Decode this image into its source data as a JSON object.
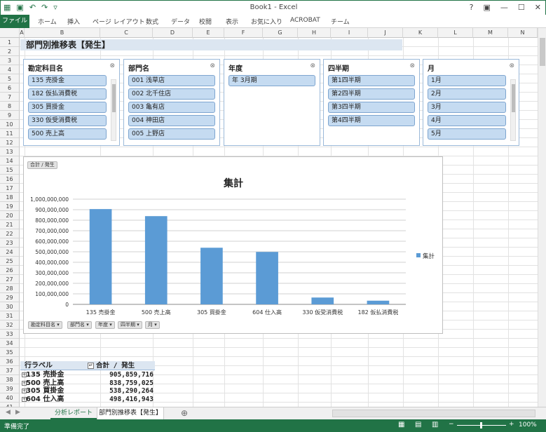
{
  "window": {
    "title": "Book1 - Excel",
    "qat_icons": [
      "excel-logo-icon",
      "save-icon",
      "undo-icon",
      "redo-icon",
      "customize-icon"
    ],
    "controls": [
      "?",
      "▣",
      "—",
      "☐",
      "✕"
    ]
  },
  "ribbon": {
    "tabs": [
      "ファイル",
      "ホーム",
      "挿入",
      "ページ レイアウト",
      "数式",
      "データ",
      "校閲",
      "表示",
      "お気に入り",
      "ACROBAT",
      "チーム"
    ]
  },
  "columns": [
    "A",
    "B",
    "C",
    "D",
    "E",
    "F",
    "G",
    "H",
    "I",
    "J",
    "K",
    "L",
    "M",
    "N"
  ],
  "rows": [
    "1",
    "2",
    "3",
    "4",
    "5",
    "6",
    "7",
    "8",
    "9",
    "10",
    "11",
    "12",
    "13",
    "14",
    "15",
    "16",
    "17",
    "18",
    "19",
    "20",
    "21",
    "22",
    "23",
    "24",
    "25",
    "26",
    "27",
    "28",
    "29",
    "30",
    "31",
    "32",
    "33",
    "34",
    "35",
    "36",
    "37",
    "38",
    "39",
    "40",
    "41"
  ],
  "sheet_title": "部門別推移表【発生】",
  "slicers": [
    {
      "title": "勘定科目名",
      "items": [
        "135 売掛金",
        "182 仮払消費税",
        "305 買掛金",
        "330 仮受消費税",
        "500 売上高"
      ],
      "scroll": true
    },
    {
      "title": "部門名",
      "items": [
        "001 浅草店",
        "002 北千住店",
        "003 亀有店",
        "004 神田店",
        "005 上野店"
      ],
      "scroll": false
    },
    {
      "title": "年度",
      "items": [
        "年 3月期"
      ],
      "scroll": false
    },
    {
      "title": "四半期",
      "items": [
        "第1四半期",
        "第2四半期",
        "第3四半期",
        "第4四半期"
      ],
      "scroll": false
    },
    {
      "title": "月",
      "items": [
        "1月",
        "2月",
        "3月",
        "4月",
        "5月"
      ],
      "scroll": true
    }
  ],
  "chart_field_top": "合計 / 発生",
  "chart_field_bottom": [
    "勘定科目名",
    "部門名",
    "年度",
    "四半期",
    "月"
  ],
  "chart_data": {
    "type": "bar",
    "title": "集計",
    "categories": [
      "135 売掛金",
      "500 売上高",
      "305 買掛金",
      "604 仕入高",
      "330 仮受消費税",
      "182 仮払消費税"
    ],
    "series": [
      {
        "name": "集計",
        "values": [
          905859716,
          838759025,
          538290264,
          498416943,
          65000000,
          35000000
        ]
      }
    ],
    "ylim": [
      0,
      1000000000
    ],
    "yticks": [
      "0",
      "100,000,000",
      "200,000,000",
      "300,000,000",
      "400,000,000",
      "500,000,000",
      "600,000,000",
      "700,000,000",
      "800,000,000",
      "900,000,000",
      "1,000,000,000"
    ],
    "legend": "right",
    "grid": true,
    "color": "#5b9bd5"
  },
  "pivot": {
    "header_label": "行ラベル",
    "header_value": "合計 / 発生",
    "rows": [
      {
        "label": "135 売掛金",
        "value": "905,859,716"
      },
      {
        "label": "500 売上高",
        "value": "838,759,025"
      },
      {
        "label": "305 買掛金",
        "value": "538,290,264"
      },
      {
        "label": "604 仕入高",
        "value": "498,416,943"
      }
    ]
  },
  "sheet_tabs": [
    "分析レポート",
    "部門別推移表【発生】"
  ],
  "status": {
    "ready": "準備完了",
    "zoom": "100%"
  }
}
